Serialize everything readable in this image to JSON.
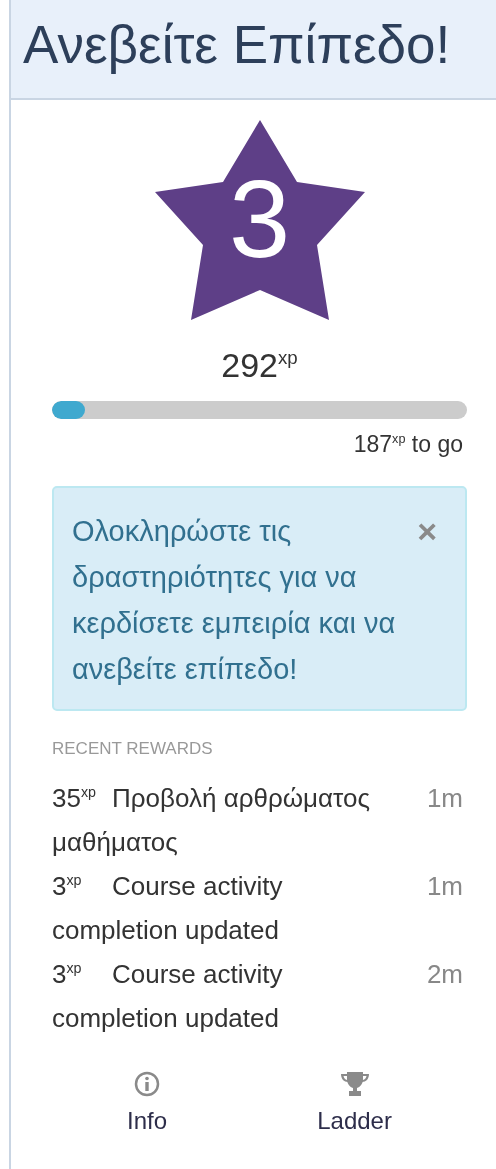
{
  "header": {
    "title": "Ανεβείτε Επίπεδο!"
  },
  "level_badge": {
    "number": "3"
  },
  "xp": {
    "total": "292$^{xp}$",
    "level": 0.08,
    "remaining": "187$^{xp}$ to go"
  },
  "notice": {
    "text": "Ολοκληρώστε τις δραστηριότητες για να κερδίσετε εμπειρία και να ανεβείτε επίπεδο!",
    "close": "×"
  },
  "recent_rewards": {
    "heading": "RECENT REWARDS",
    "items": [
      {
        "xp": "35$^{xp}$",
        "description": "Προβολή αρθρώματος μαθήματος",
        "time": "1m"
      },
      {
        "xp": "3$^{xp}$",
        "description": "Course activity completion updated",
        "time": "1m"
      },
      {
        "xp": "3$^{xp}$",
        "description": "Course activity completion updated",
        "time": "2m"
      }
    ]
  },
  "footer_links": [
    {
      "kind": "info",
      "label": "Info"
    },
    {
      "kind": "trophy",
      "label": "Ladder"
    }
  ]
}
